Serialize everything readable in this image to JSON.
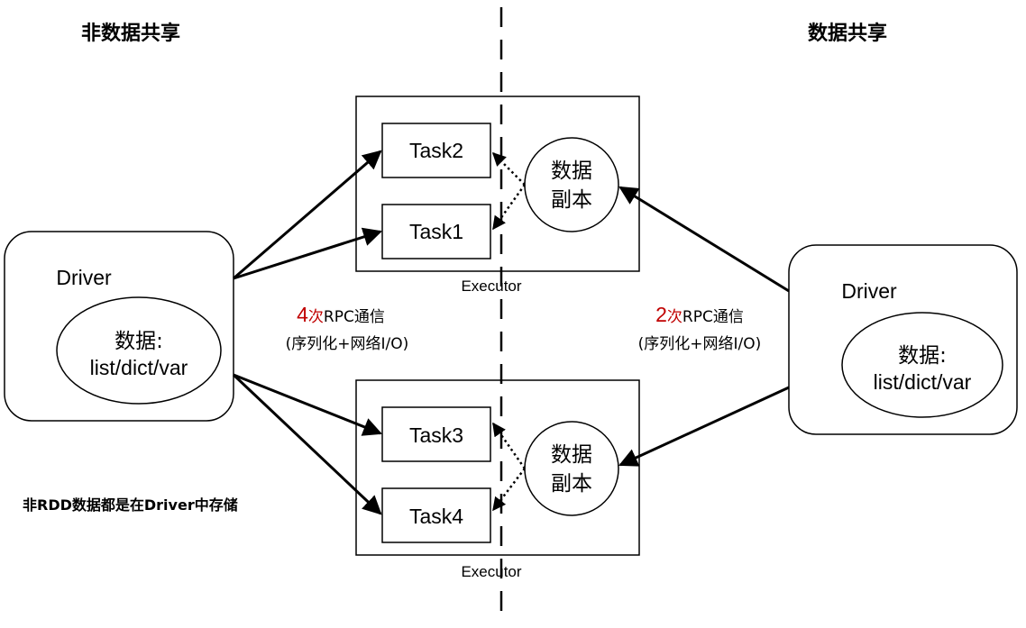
{
  "titles": {
    "left": "非数据共享",
    "right": "数据共享"
  },
  "note": "非RDD数据都是在Driver中存储",
  "left_driver": {
    "label": "Driver",
    "data_line1": "数据:",
    "data_line2": "list/dict/var"
  },
  "right_driver": {
    "label": "Driver",
    "data_line1": "数据:",
    "data_line2": "list/dict/var"
  },
  "executors": [
    {
      "label": "Executor",
      "tasks": [
        "Task2",
        "Task1"
      ],
      "copy_line1": "数据",
      "copy_line2": "副本"
    },
    {
      "label": "Executor",
      "tasks": [
        "Task3",
        "Task4"
      ],
      "copy_line1": "数据",
      "copy_line2": "副本"
    }
  ],
  "rpc_left": {
    "count": "4",
    "text": "次RPC通信",
    "detail": "(序列化+网络I/O)"
  },
  "rpc_right": {
    "count": "2",
    "text": "次RPC通信",
    "detail": "(序列化+网络I/O)"
  },
  "colors": {
    "accent_red": "#c00000",
    "line": "#000000"
  }
}
